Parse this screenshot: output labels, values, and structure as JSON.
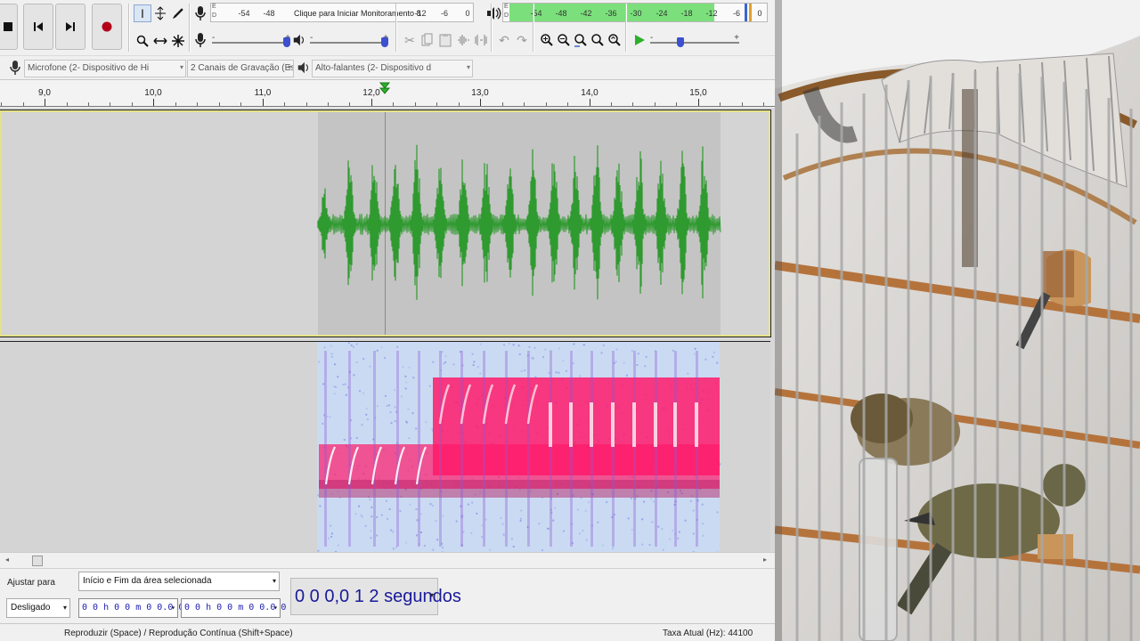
{
  "recording_meter": {
    "ticks": [
      "-54",
      "-48",
      "-12",
      "-6",
      "0"
    ],
    "message": "Clique para Iniciar Monitoramento 8",
    "e_label": "E",
    "d_label": "D"
  },
  "playback_meter": {
    "ticks": [
      "-54",
      "-48",
      "-42",
      "-36",
      "-30",
      "-24",
      "-18",
      "-12",
      "-6",
      "0"
    ],
    "e_label": "E",
    "d_label": "D"
  },
  "slider_minus": "-",
  "slider_plus": "+",
  "device_toolbar": {
    "microphone": "Microfone (2- Dispositivo de Hi",
    "channels": "2 Canais de  Gravação (Esté",
    "speakers": "Alto-falantes (2- Dispositivo d"
  },
  "ruler": {
    "labels": [
      "9,0",
      "10,0",
      "11,0",
      "12,0",
      "13,0",
      "14,0",
      "15,0"
    ]
  },
  "selection_toolbar": {
    "snap_label": "Ajustar para",
    "snap_value": "Desligado",
    "mode_value": "Início e Fim da área selecionada",
    "start_time": "0 0 h 0 0 m 0 0.0 0 0 s",
    "end_time": "0 0 h 0 0 m 0 0.0 0 0 s"
  },
  "time_display": "0 0 0,0 1 2  segundos",
  "status": {
    "left": "Reproduzir (Space) / Reprodução Contínua (Shift+Space)",
    "right": "Taxa Atual (Hz): 44100"
  },
  "colors": {
    "waveform": "#2f9a2f",
    "meter_green": "#7be07b",
    "selection_bg": "#c4c4c4",
    "spectrogram_low": "#bcd0f0",
    "spectrogram_high": "#ff1a6a"
  }
}
